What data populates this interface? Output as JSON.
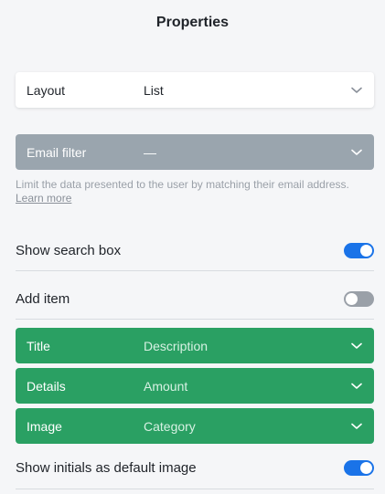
{
  "panel": {
    "title": "Properties"
  },
  "layout": {
    "label": "Layout",
    "value": "List"
  },
  "email_filter": {
    "label": "Email filter",
    "value": "—",
    "help_text": "Limit the data presented to the user by matching their email address.",
    "help_link": "Learn more"
  },
  "show_search_box": {
    "label": "Show search box",
    "enabled": true
  },
  "add_item": {
    "label": "Add item",
    "enabled": false
  },
  "mappings": [
    {
      "label": "Title",
      "value": "Description"
    },
    {
      "label": "Details",
      "value": "Amount"
    },
    {
      "label": "Image",
      "value": "Category"
    }
  ],
  "show_initials": {
    "label": "Show initials as default image",
    "enabled": true
  },
  "colors": {
    "accent": "#1a73e8",
    "mapping_green": "#2aa063",
    "disabled_gray": "#9aa5ae"
  },
  "icons": {
    "dropdown": "chevron-down-icon"
  }
}
